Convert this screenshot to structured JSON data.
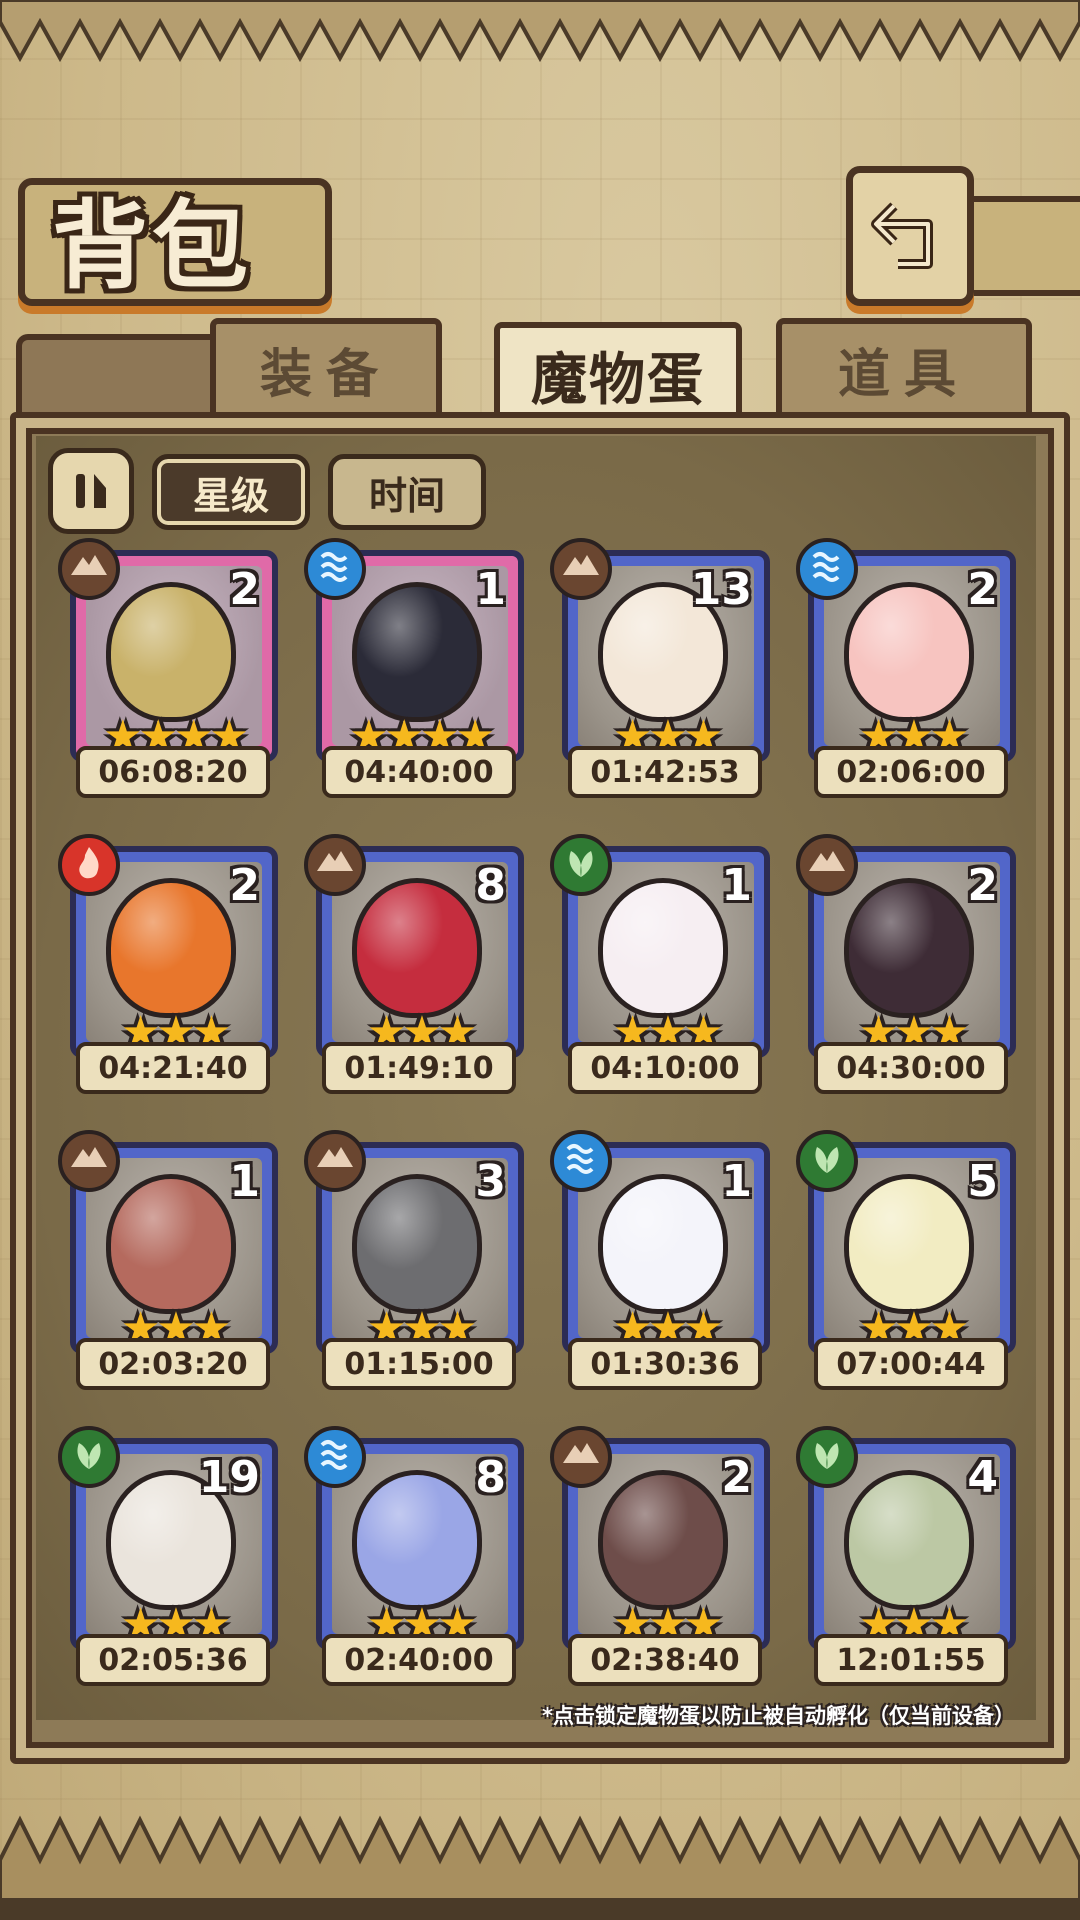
{
  "header": {
    "title": "背包"
  },
  "tabs": [
    {
      "label": "装备",
      "active": false
    },
    {
      "label": "魔物蛋",
      "active": true
    },
    {
      "label": "道具",
      "active": false
    }
  ],
  "sort": {
    "star_label": "星级",
    "time_label": "时间",
    "active": "星级"
  },
  "colors": {
    "rare_frame": "#e06aa8",
    "normal_frame": "#5266c9",
    "star": "#f6b81e"
  },
  "eggs": [
    {
      "element": "earth",
      "rarity": "pink",
      "count": "2",
      "stars": 4,
      "timer": "06:08:20",
      "egg_color": "#c9b26a"
    },
    {
      "element": "water",
      "rarity": "pink",
      "count": "1",
      "stars": 4,
      "timer": "04:40:00",
      "egg_color": "#2b2b38"
    },
    {
      "element": "earth",
      "rarity": "blue",
      "count": "13",
      "stars": 3,
      "timer": "01:42:53",
      "egg_color": "#f3e7d8"
    },
    {
      "element": "water",
      "rarity": "blue",
      "count": "2",
      "stars": 3,
      "timer": "02:06:00",
      "egg_color": "#f7c4c0"
    },
    {
      "element": "fire",
      "rarity": "blue",
      "count": "2",
      "stars": 3,
      "timer": "04:21:40",
      "egg_color": "#e8762c"
    },
    {
      "element": "earth",
      "rarity": "blue",
      "count": "8",
      "stars": 3,
      "timer": "01:49:10",
      "egg_color": "#c52d3e"
    },
    {
      "element": "leaf",
      "rarity": "blue",
      "count": "1",
      "stars": 3,
      "timer": "04:10:00",
      "egg_color": "#f6eef2"
    },
    {
      "element": "earth",
      "rarity": "blue",
      "count": "2",
      "stars": 3,
      "timer": "04:30:00",
      "egg_color": "#3e2c36"
    },
    {
      "element": "earth",
      "rarity": "blue",
      "count": "1",
      "stars": 3,
      "timer": "02:03:20",
      "egg_color": "#b56a5e"
    },
    {
      "element": "earth",
      "rarity": "blue",
      "count": "3",
      "stars": 3,
      "timer": "01:15:00",
      "egg_color": "#6d6d70"
    },
    {
      "element": "water",
      "rarity": "blue",
      "count": "1",
      "stars": 3,
      "timer": "01:30:36",
      "egg_color": "#f4f4fa"
    },
    {
      "element": "leaf",
      "rarity": "blue",
      "count": "5",
      "stars": 3,
      "timer": "07:00:44",
      "egg_color": "#f2ecc2"
    },
    {
      "element": "leaf",
      "rarity": "blue",
      "count": "19",
      "stars": 3,
      "timer": "02:05:36",
      "egg_color": "#eae4dc"
    },
    {
      "element": "water",
      "rarity": "blue",
      "count": "8",
      "stars": 3,
      "timer": "02:40:00",
      "egg_color": "#9aa6e6"
    },
    {
      "element": "earth",
      "rarity": "blue",
      "count": "2",
      "stars": 3,
      "timer": "02:38:40",
      "egg_color": "#6e4d4a"
    },
    {
      "element": "leaf",
      "rarity": "blue",
      "count": "4",
      "stars": 3,
      "timer": "12:01:55",
      "egg_color": "#bcc8a4"
    }
  ],
  "footer_note": "*点击锁定魔物蛋以防止被自动孵化（仅当前设备）"
}
